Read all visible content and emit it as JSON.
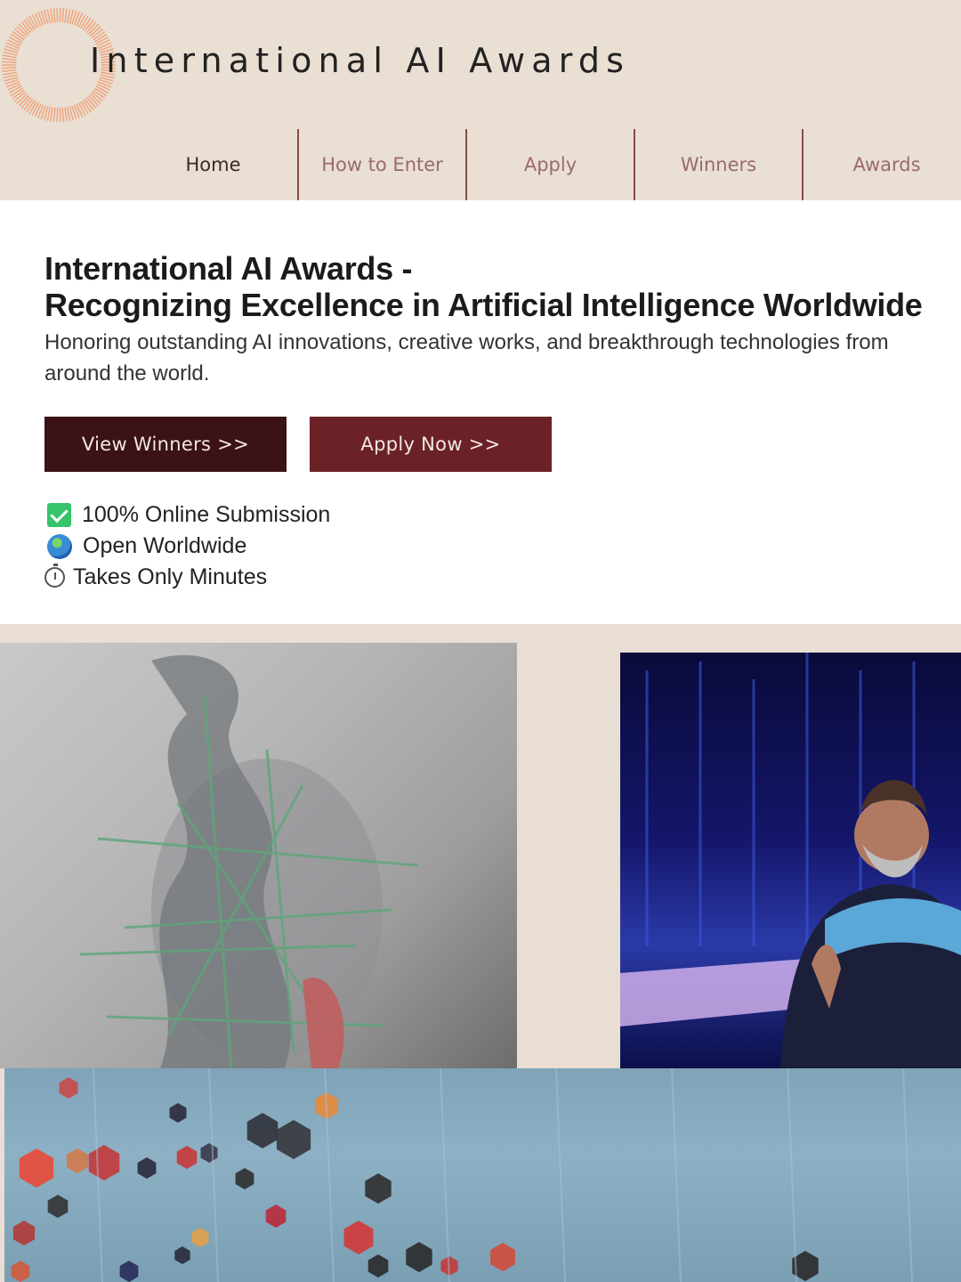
{
  "header": {
    "site_title": "International AI Awards",
    "logo_name": "sunburst-ring-logo",
    "accent_color": "#f0a27a"
  },
  "nav": {
    "items": [
      {
        "label": "Home"
      },
      {
        "label": "How to Enter"
      },
      {
        "label": "Apply"
      },
      {
        "label": "Winners"
      },
      {
        "label": "Awards"
      }
    ]
  },
  "hero": {
    "title_line1": "International AI Awards -",
    "title_line2": "Recognizing Excellence in Artificial Intelligence Worldwide",
    "subtitle": "Honoring outstanding AI innovations, creative works, and breakthrough technologies from around the world.",
    "btn_winners": "View Winners >>",
    "btn_apply": "Apply Now >>",
    "features": [
      {
        "icon": "check-box-icon",
        "text": "100% Online Submission"
      },
      {
        "icon": "globe-icon",
        "text": "Open Worldwide"
      },
      {
        "icon": "stopwatch-icon",
        "text": "Takes Only Minutes"
      }
    ]
  },
  "gallery": {
    "images": [
      {
        "name": "abstract-sculpture-artwork"
      },
      {
        "name": "speaker-on-stage-photo"
      },
      {
        "name": "floating-hexagons-artwork"
      }
    ]
  },
  "colors": {
    "header_bg": "#e9dfd3",
    "button_dark": "#3b1216",
    "button_red": "#6b2227",
    "nav_text": "#9b6a6a",
    "nav_divider": "#8a4a4a"
  }
}
